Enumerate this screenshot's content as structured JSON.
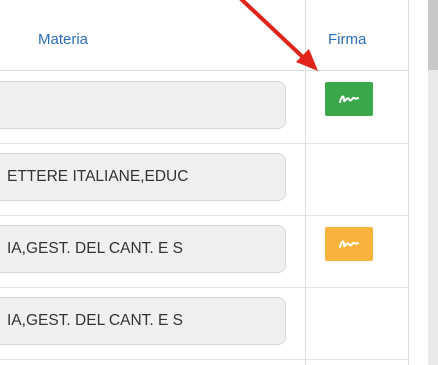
{
  "header": {
    "materia_label": "Materia",
    "firma_label": "Firma"
  },
  "rows": [
    {
      "materia": "",
      "signature": "green"
    },
    {
      "materia": "ETTERE ITALIANE,EDUC",
      "signature": "none"
    },
    {
      "materia": "IA,GEST. DEL CANT. E S",
      "signature": "orange"
    },
    {
      "materia": "IA,GEST. DEL CANT. E S",
      "signature": "none"
    }
  ],
  "colors": {
    "header_text": "#2a6ebb",
    "sign_green": "#3aa84a",
    "sign_orange": "#f7b33b",
    "annotation_arrow": "#e2231a"
  },
  "icons": {
    "signature": "signature-icon",
    "annotation": "red-arrow-annotation"
  }
}
